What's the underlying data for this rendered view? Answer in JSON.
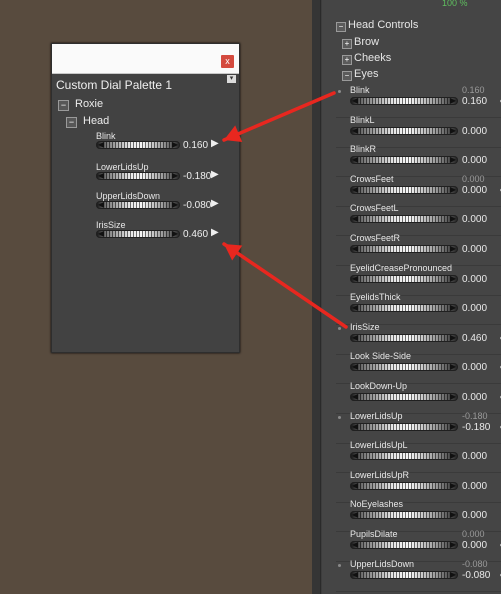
{
  "right_panel": {
    "percent": "100 %",
    "tree": [
      {
        "label": "Head Controls",
        "sign": "−"
      },
      {
        "label": "Brow",
        "sign": "+"
      },
      {
        "label": "Cheeks",
        "sign": "+"
      },
      {
        "label": "Eyes",
        "sign": "−"
      }
    ],
    "dials": [
      {
        "label": "Blink",
        "value": "0.160",
        "small": "0.160",
        "dot": true,
        "link": true
      },
      {
        "label": "BlinkL",
        "value": "0.000",
        "small": "",
        "dot": false,
        "link": false
      },
      {
        "label": "BlinkR",
        "value": "0.000",
        "small": "",
        "dot": false,
        "link": false
      },
      {
        "label": "CrowsFeet",
        "value": "0.000",
        "small": "0.000",
        "dot": false,
        "link": true
      },
      {
        "label": "CrowsFeetL",
        "value": "0.000",
        "small": "",
        "dot": false,
        "link": false
      },
      {
        "label": "CrowsFeetR",
        "value": "0.000",
        "small": "",
        "dot": false,
        "link": false
      },
      {
        "label": "EyelidCreasePronounced",
        "value": "0.000",
        "small": "",
        "dot": false,
        "link": false
      },
      {
        "label": "EyelidsThick",
        "value": "0.000",
        "small": "",
        "dot": false,
        "link": false
      },
      {
        "label": "IrisSize",
        "value": "0.460",
        "small": "",
        "dot": true,
        "link": true
      },
      {
        "label": "Look Side-Side",
        "value": "0.000",
        "small": "",
        "dot": false,
        "link": true
      },
      {
        "label": "LookDown-Up",
        "value": "0.000",
        "small": "",
        "dot": false,
        "link": true
      },
      {
        "label": "LowerLidsUp",
        "value": "-0.180",
        "small": "-0.180",
        "dot": true,
        "link": true
      },
      {
        "label": "LowerLidsUpL",
        "value": "0.000",
        "small": "",
        "dot": false,
        "link": false
      },
      {
        "label": "LowerLidsUpR",
        "value": "0.000",
        "small": "",
        "dot": false,
        "link": false
      },
      {
        "label": "NoEyelashes",
        "value": "0.000",
        "small": "",
        "dot": false,
        "link": false
      },
      {
        "label": "PupilsDilate",
        "value": "0.000",
        "small": "0.000",
        "dot": false,
        "link": true
      },
      {
        "label": "UpperLidsDown",
        "value": "-0.080",
        "small": "-0.080",
        "dot": true,
        "link": true
      }
    ]
  },
  "palette": {
    "close_glyph": "x",
    "menu_glyph": "▾",
    "title": "Custom Dial Palette 1",
    "figure": "Roxie",
    "group": "Head",
    "dials": [
      {
        "label": "Blink",
        "value": "0.160"
      },
      {
        "label": "LowerLidsUp",
        "value": "-0.180"
      },
      {
        "label": "UpperLidsDown",
        "value": "-0.080"
      },
      {
        "label": "IrisSize",
        "value": "0.460"
      }
    ]
  },
  "icons": {
    "play": "▶",
    "link": "⚬⚬",
    "collapse": "−",
    "expand": "+",
    "left_arrow": "◀",
    "right_arrow": "▶"
  },
  "colors": {
    "arrow": "#e8271f",
    "close_button": "#d44a3e",
    "percent": "#5fbf5f"
  }
}
